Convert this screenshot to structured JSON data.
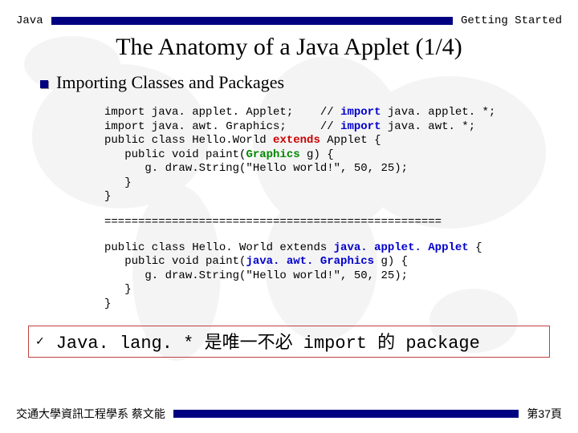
{
  "header": {
    "left": "Java",
    "right": "Getting Started"
  },
  "title": "The Anatomy of a Java Applet (1/4)",
  "section_heading": "Importing Classes and Packages",
  "code": {
    "l1a": "import java. applet. Applet;    // ",
    "l1b": "import",
    "l1c": " java. applet. *;",
    "l2a": "import java. awt. Graphics;     // ",
    "l2b": "import",
    "l2c": " java. awt. *;",
    "l3a": "public class Hello.World ",
    "l3b": "extends",
    "l3c": " Applet {",
    "l4a": "   public void paint(",
    "l4b": "Graphics",
    "l4c": " g) {",
    "l5": "      g. draw.String(\"Hello world!\", 50, 25);",
    "l6": "   }",
    "l7": "}"
  },
  "divider": "==================================================",
  "code2": {
    "l1a": "public class Hello. World extends ",
    "l1b": "java. applet. Applet",
    "l1c": " {",
    "l2a": "   public void paint(",
    "l2b": "java. awt. Graphics",
    "l2c": " g) {",
    "l3": "      g. draw.String(\"Hello world!\", 50, 25);",
    "l4": "   }",
    "l5": "}"
  },
  "note": {
    "check": "✓",
    "text": "Java. lang. * 是唯一不必 import 的 package"
  },
  "footer": {
    "left": "交通大學資訊工程學系 蔡文能",
    "right": "第37頁"
  }
}
